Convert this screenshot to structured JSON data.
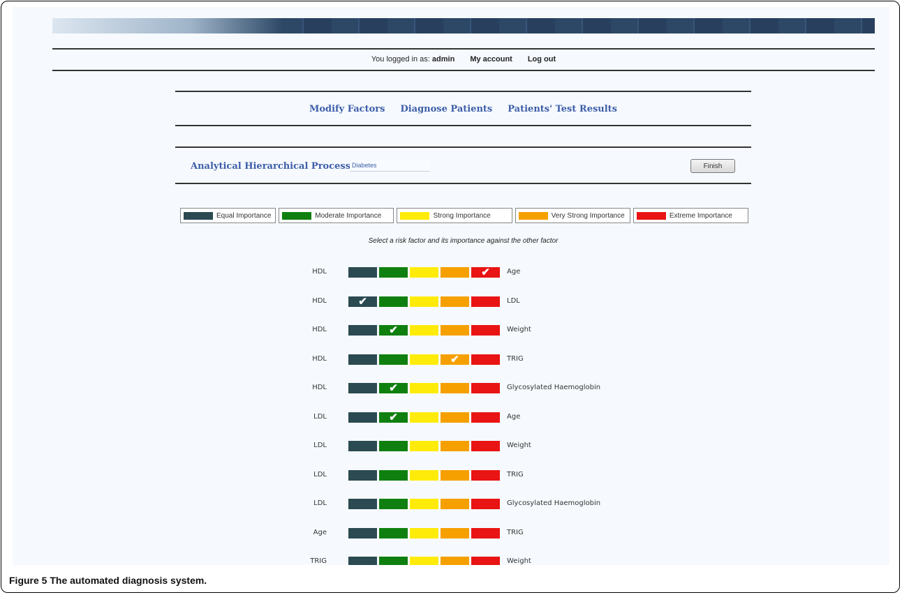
{
  "colors": {
    "equal": "#2b4a52",
    "moderate": "#0f8010",
    "strong": "#ffeb0a",
    "very_strong": "#f6a000",
    "extreme": "#e91414",
    "link": "#3d5da8"
  },
  "user_bar": {
    "logged_in_prefix": "You logged in as:",
    "username": "admin",
    "my_account": "My account",
    "log_out": "Log out"
  },
  "nav": {
    "items": [
      "Modify Factors",
      "Diagnose Patients",
      "Patients' Test Results"
    ]
  },
  "ahp": {
    "label": "Analytical Hierarchical Process for:",
    "disease_value": "Diabetes",
    "finish_label": "Finish"
  },
  "legend": [
    {
      "label": "Equal Importance",
      "color": "#2b4a52"
    },
    {
      "label": "Moderate Importance",
      "color": "#0f8010"
    },
    {
      "label": "Strong Importance",
      "color": "#ffeb0a"
    },
    {
      "label": "Very Strong Importance",
      "color": "#f6a000"
    },
    {
      "label": "Extreme Importance",
      "color": "#e91414"
    }
  ],
  "instruction": "Select a risk factor and its importance against the other factor",
  "comparisons": [
    {
      "left": "HDL",
      "right": "Age",
      "selected": 4
    },
    {
      "left": "HDL",
      "right": "LDL",
      "selected": 0
    },
    {
      "left": "HDL",
      "right": "Weight",
      "selected": 1
    },
    {
      "left": "HDL",
      "right": "TRIG",
      "selected": 3
    },
    {
      "left": "HDL",
      "right": "Glycosylated Haemoglobin",
      "selected": 1
    },
    {
      "left": "LDL",
      "right": "Age",
      "selected": 1
    },
    {
      "left": "LDL",
      "right": "Weight",
      "selected": null
    },
    {
      "left": "LDL",
      "right": "TRIG",
      "selected": null
    },
    {
      "left": "LDL",
      "right": "Glycosylated Haemoglobin",
      "selected": null
    },
    {
      "left": "Age",
      "right": "TRIG",
      "selected": null
    },
    {
      "left": "TRIG",
      "right": "Weight",
      "selected": null
    }
  ],
  "caption": {
    "label": "Figure 5",
    "text": "The automated diagnosis system."
  }
}
